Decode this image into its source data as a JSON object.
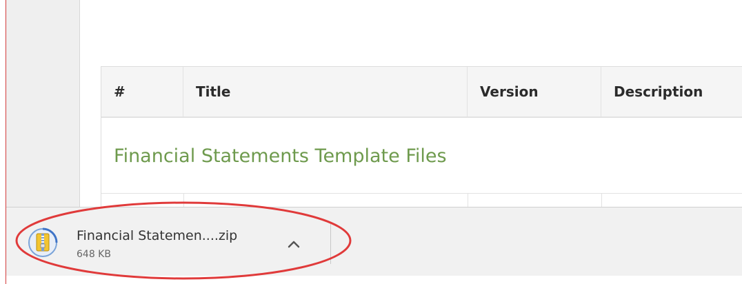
{
  "table": {
    "headers": [
      "#",
      "Title",
      "Version",
      "Description"
    ],
    "group_title": "Financial Statements Template Files"
  },
  "download": {
    "file_name": "Financial Statemen....zip",
    "file_size": "648 KB"
  },
  "colors": {
    "group_title": "#6e9a4d",
    "highlight": "#e03a3a"
  }
}
